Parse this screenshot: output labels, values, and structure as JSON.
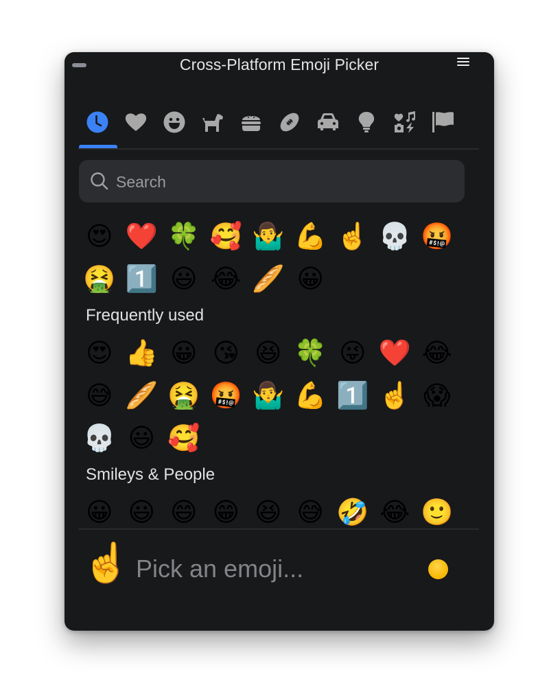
{
  "window": {
    "title": "Cross-Platform Emoji Picker",
    "minimize_icon": "minimize-icon",
    "menu_icon": "hamburger-menu-icon"
  },
  "colors": {
    "accent": "#3b82f6",
    "background": "#18191b",
    "search_bg": "#2c2d30",
    "tab_icon": "#a8a8a8",
    "skin_tone": "#f7b500"
  },
  "tabs": [
    {
      "name": "recent",
      "icon": "clock-icon",
      "active": true
    },
    {
      "name": "favorites",
      "icon": "heart-icon",
      "active": false
    },
    {
      "name": "smileys-people",
      "icon": "smiley-icon",
      "active": false
    },
    {
      "name": "animals-nature",
      "icon": "dog-icon",
      "active": false
    },
    {
      "name": "food-drink",
      "icon": "burger-icon",
      "active": false
    },
    {
      "name": "activities",
      "icon": "football-icon",
      "active": false
    },
    {
      "name": "travel-places",
      "icon": "car-icon",
      "active": false
    },
    {
      "name": "objects",
      "icon": "lightbulb-icon",
      "active": false
    },
    {
      "name": "symbols",
      "icon": "symbols-icon",
      "active": false
    },
    {
      "name": "flags",
      "icon": "flag-icon",
      "active": false
    }
  ],
  "search": {
    "placeholder": "Search",
    "value": ""
  },
  "sections": {
    "recent": {
      "label": "",
      "rows": [
        [
          "😍",
          "❤️",
          "🍀",
          "🥰",
          "🤷‍♂️",
          "💪",
          "☝️",
          "💀",
          "🤬"
        ],
        [
          "🤮",
          "1️⃣",
          "😃",
          "😂",
          "🥖",
          "😀"
        ]
      ]
    },
    "frequent": {
      "label": "Frequently used",
      "rows": [
        [
          "😍",
          "👍",
          "😀",
          "😘",
          "😆",
          "🍀",
          "😜",
          "❤️",
          "😂"
        ],
        [
          "😅",
          "🥖",
          "🤮",
          "🤬",
          "🤷‍♂️",
          "💪",
          "1️⃣",
          "☝️",
          "😱"
        ],
        [
          "💀",
          "😃",
          "🥰"
        ]
      ]
    },
    "smileys": {
      "label": "Smileys & People",
      "rows": [
        [
          "😀",
          "😃",
          "😄",
          "😁",
          "😆",
          "😅",
          "🤣",
          "😂",
          "🙂"
        ]
      ]
    }
  },
  "preview": {
    "emoji": "☝️",
    "placeholder_text": "Pick an emoji...",
    "skin_tone_label": "default-skin-tone"
  }
}
